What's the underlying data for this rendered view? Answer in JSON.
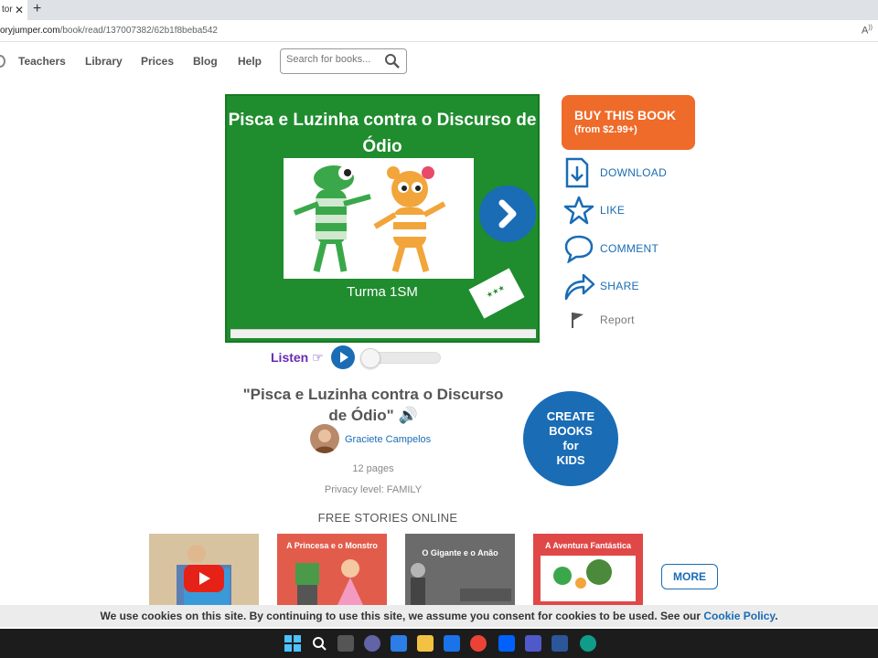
{
  "browser": {
    "tab_title": "tor",
    "url_domain": "oryjumper.com",
    "url_path": "/book/read/137007382/62b1f8beba542",
    "reader_icon": "read-aloud-icon"
  },
  "nav": {
    "items": [
      "Teachers",
      "Library",
      "Prices",
      "Blog",
      "Help"
    ],
    "search_placeholder": "Search for books..."
  },
  "book": {
    "cover_title": "Pisca e Luzinha contra o Discurso de Ódio",
    "cover_subtitle": "Turma 1SM",
    "colors": {
      "cover": "#1f8c2e",
      "accent": "#1a6cb5"
    },
    "listen_label": "Listen",
    "title": "\"Pisca e Luzinha contra o Discurso de Ódio\"",
    "author": "Graciete Campelos",
    "pages": "12 pages",
    "privacy": "Privacy level: FAMILY"
  },
  "actions": {
    "buy_line1": "BUY THIS BOOK",
    "buy_line2": "(from $2.99+)",
    "download": "DOWNLOAD",
    "like": "LIKE",
    "comment": "COMMENT",
    "share": "SHARE",
    "report": "Report",
    "buy_color": "#ef6b2a"
  },
  "create": {
    "l1": "CREATE",
    "l2": "BOOKS",
    "l3": "for",
    "l4": "KIDS"
  },
  "free_stories": {
    "heading": "FREE STORIES ONLINE",
    "thumbs": [
      "",
      "A Princesa e o Monstro",
      "O Gigante e o Anão",
      "A Aventura Fantástica"
    ],
    "more": "MORE"
  },
  "cookie": {
    "text": "We use cookies on this site. By continuing to use this site, we assume you consent for cookies to be used. See our ",
    "link": "Cookie Policy",
    "end": "."
  }
}
